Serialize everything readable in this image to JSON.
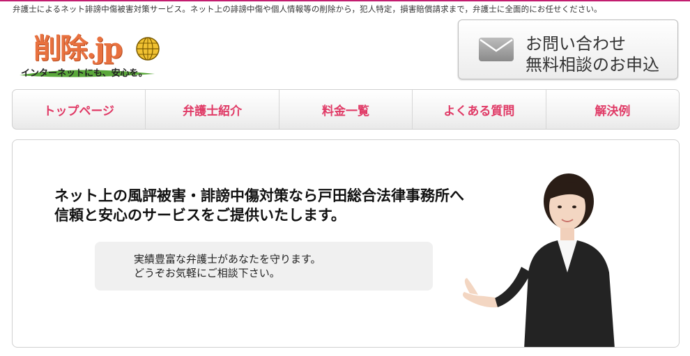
{
  "header": {
    "tagline": "弁護士によるネット誹謗中傷被害対策サービス。ネット上の誹謗中傷や個人情報等の削除から，犯人特定，損害賠償請求まで，弁護士に全面的にお任せください。",
    "logo_text": "削除.jp",
    "logo_sub": "インターネットにも、安心を。"
  },
  "contact": {
    "line1": "お問い合わせ",
    "line2": "無料相談のお申込",
    "icon": "mail-icon"
  },
  "nav": {
    "items": [
      {
        "label": "トップページ"
      },
      {
        "label": "弁護士紹介"
      },
      {
        "label": "料金一覧"
      },
      {
        "label": "よくある質問"
      },
      {
        "label": "解決例"
      }
    ]
  },
  "hero": {
    "headline1": "ネット上の風評被害・誹謗中傷対策なら戸田総合法律事務所へ",
    "headline2": "信頼と安心のサービスをご提供いたします。",
    "bubble1": "実績豊富な弁護士があなたを守ります。",
    "bubble2": "どうぞお気軽にご相談下さい。"
  },
  "colors": {
    "accent": "#e03a66",
    "logo": "#e8713f",
    "topline": "#c21d6f"
  }
}
